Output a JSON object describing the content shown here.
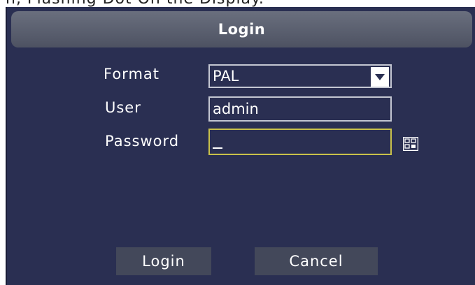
{
  "top_strip_text": "n, Flashing Dot On the Display. ",
  "dialog": {
    "title": "Login"
  },
  "fields": {
    "format": {
      "label": "Format",
      "value": "PAL"
    },
    "user": {
      "label": "User",
      "value": "admin"
    },
    "password": {
      "label": "Password",
      "value": ""
    }
  },
  "buttons": {
    "login": "Login",
    "cancel": "Cancel"
  },
  "icons": {
    "dropdown": "chevron-down-icon",
    "keyboard": "keyboard-icon"
  },
  "colors": {
    "panel": "#2a2f52",
    "titlebar": "#5a5f70",
    "focus_border": "#c9c14a",
    "button": "#43485a"
  }
}
